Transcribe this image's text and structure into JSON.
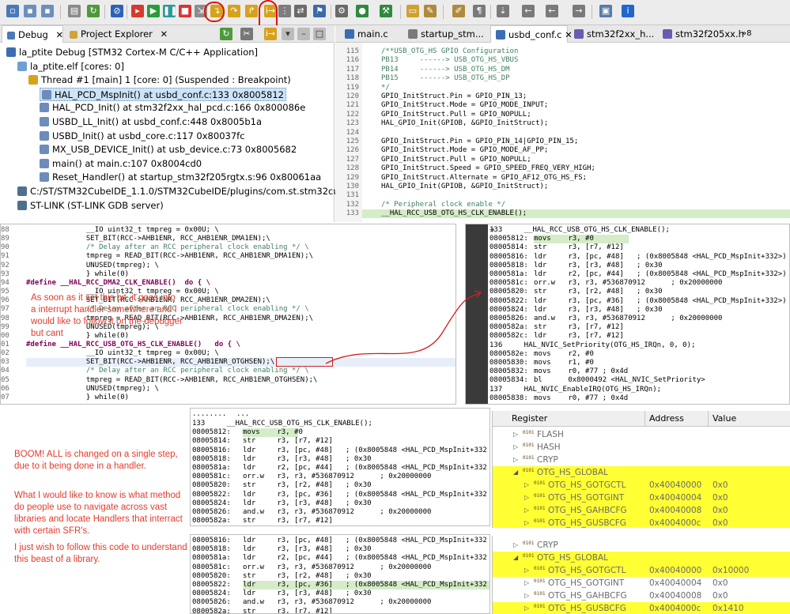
{
  "toolbar": {
    "icons": [
      "new-icon",
      "save-icon",
      "save-all-icon",
      "debug-icon",
      "skip-icon",
      "resume-icon",
      "suspend-icon",
      "terminate-icon",
      "disconnect-icon",
      "step-into-icon",
      "step-over-icon",
      "step-return-icon",
      "instruction-step-icon",
      "build-icon",
      "search-icon",
      "info-icon"
    ],
    "info_label": "i"
  },
  "debug_view": {
    "tabs": [
      {
        "label": "Debug",
        "close": "✕"
      },
      {
        "label": "Project Explorer",
        "close": "✕"
      }
    ],
    "tree": [
      {
        "label": "la_ptite Debug [STM32 Cortex-M C/C++ Application]",
        "indent": 0,
        "icon": "ide"
      },
      {
        "label": "la_ptite.elf [cores: 0]",
        "indent": 1,
        "icon": "app"
      },
      {
        "label": "Thread #1 [main] 1 [core: 0] (Suspended : Breakpoint)",
        "indent": 2,
        "icon": "thread"
      },
      {
        "label": "HAL_PCD_MspInit() at usbd_conf.c:133 0x8005812",
        "indent": 3,
        "icon": "frame",
        "selected": true
      },
      {
        "label": "HAL_PCD_Init() at stm32f2xx_hal_pcd.c:166 0x800086e",
        "indent": 3,
        "icon": "frame"
      },
      {
        "label": "USBD_LL_Init() at usbd_conf.c:448 0x8005b1a",
        "indent": 3,
        "icon": "frame"
      },
      {
        "label": "USBD_Init() at usbd_core.c:117 0x80037fc",
        "indent": 3,
        "icon": "frame"
      },
      {
        "label": "MX_USB_DEVICE_Init() at usb_device.c:73 0x8005682",
        "indent": 3,
        "icon": "frame"
      },
      {
        "label": "main() at main.c:107 0x8004cd0",
        "indent": 3,
        "icon": "frame"
      },
      {
        "label": "Reset_Handler() at startup_stm32f205rgtx.s:96 0x80061aa",
        "indent": 3,
        "icon": "frame"
      },
      {
        "label": "C:/ST/STM32CubeIDE_1.1.0/STM32CubeIDE/plugins/com.st.stm32cube.ide.mc",
        "indent": 1,
        "icon": "gdb"
      },
      {
        "label": "ST-LINK (ST-LINK GDB server)",
        "indent": 1,
        "icon": "gdb"
      }
    ]
  },
  "editor": {
    "tabs": [
      {
        "label": "main.c"
      },
      {
        "label": "startup_stm..."
      },
      {
        "label": "usbd_conf.c",
        "active": true,
        "close": "✕"
      },
      {
        "label": "stm32f2xx_h..."
      },
      {
        "label": "stm32f205xx.h"
      },
      {
        "label": "»8"
      }
    ],
    "lines": [
      {
        "n": "115",
        "t": "/**USB_OTG_HS GPIO Configuration",
        "c": "cm"
      },
      {
        "n": "116",
        "t": "PB13     ------> USB_OTG_HS_VBUS",
        "c": "cm"
      },
      {
        "n": "117",
        "t": "PB14     ------> USB_OTG_HS_DM",
        "c": "cm"
      },
      {
        "n": "118",
        "t": "PB15     ------> USB_OTG_HS_DP",
        "c": "cm"
      },
      {
        "n": "119",
        "t": "*/",
        "c": "cm"
      },
      {
        "n": "120",
        "t": "GPIO_InitStruct.Pin = GPIO_PIN_13;"
      },
      {
        "n": "121",
        "t": "GPIO_InitStruct.Mode = GPIO_MODE_INPUT;"
      },
      {
        "n": "122",
        "t": "GPIO_InitStruct.Pull = GPIO_NOPULL;"
      },
      {
        "n": "123",
        "t": "HAL_GPIO_Init(GPIOB, &GPIO_InitStruct);"
      },
      {
        "n": "124",
        "t": ""
      },
      {
        "n": "125",
        "t": "GPIO_InitStruct.Pin = GPIO_PIN_14|GPIO_PIN_15;"
      },
      {
        "n": "126",
        "t": "GPIO_InitStruct.Mode = GPIO_MODE_AF_PP;"
      },
      {
        "n": "127",
        "t": "GPIO_InitStruct.Pull = GPIO_NOPULL;"
      },
      {
        "n": "128",
        "t": "GPIO_InitStruct.Speed = GPIO_SPEED_FREQ_VERY_HIGH;"
      },
      {
        "n": "129",
        "t": "GPIO_InitStruct.Alternate = GPIO_AF12_OTG_HS_FS;"
      },
      {
        "n": "130",
        "t": "HAL_GPIO_Init(GPIOB, &GPIO_InitStruct);"
      },
      {
        "n": "131",
        "t": ""
      },
      {
        "n": "132",
        "t": "/* Peripheral clock enable */",
        "c": "cm"
      },
      {
        "n": "133",
        "t": "__HAL_RCC_USB_OTG_HS_CLK_ENABLE();",
        "hl": true
      }
    ]
  },
  "macro_pane": {
    "lines": [
      {
        "n": "88",
        "t": "              __IO uint32_t tmpreg = 0x00U; \\"
      },
      {
        "n": "89",
        "t": "              SET_BIT(RCC->AHB1ENR, RCC_AHB1ENR_DMA1EN);\\"
      },
      {
        "n": "90",
        "t": "              /* Delay after an RCC peripheral clock enabling */ \\",
        "c": "cm"
      },
      {
        "n": "91",
        "t": "              tmpreg = READ_BIT(RCC->AHB1ENR, RCC_AHB1ENR_DMA1EN);\\"
      },
      {
        "n": "92",
        "t": "              UNUSED(tmpreg); \\"
      },
      {
        "n": "93",
        "t": "              } while(0)"
      },
      {
        "n": "94",
        "t": "#define __HAL_RCC_DMA2_CLK_ENABLE()  do { \\",
        "c": "kw"
      },
      {
        "n": "95",
        "t": "              __IO uint32_t tmpreg = 0x00U; \\"
      },
      {
        "n": "96",
        "t": "              SET_BIT(RCC->AHB1ENR, RCC_AHB1ENR_DMA2EN);\\"
      },
      {
        "n": "97",
        "t": "              /* Delay after an RCC peripheral clock enabling */ \\",
        "c": "cm"
      },
      {
        "n": "98",
        "t": "              tmpreg = READ_BIT(RCC->AHB1ENR, RCC_AHB1ENR_DMA2EN);\\"
      },
      {
        "n": "99",
        "t": "              UNUSED(tmpreg); \\"
      },
      {
        "n": "00",
        "t": "              } while(0)"
      },
      {
        "n": "01",
        "t": "#define __HAL_RCC_USB_OTG_HS_CLK_ENABLE()   do { \\",
        "c": "kw"
      },
      {
        "n": "02",
        "t": "              __IO uint32_t tmpreg = 0x00U; \\"
      },
      {
        "n": "03",
        "t": "              SET_BIT(RCC->AHB1ENR, RCC_AHB1ENR_OTGHSEN);\\",
        "hl": true
      },
      {
        "n": "04",
        "t": "              /* Delay after an RCC peripheral clock enabling */ \\",
        "c": "cm"
      },
      {
        "n": "05",
        "t": "              tmpreg = READ_BIT(RCC->AHB1ENR, RCC_AHB1ENR_OTGHSEN);\\"
      },
      {
        "n": "06",
        "t": "              UNUSED(tmpreg); \\"
      },
      {
        "n": "07",
        "t": "              } while(0)"
      }
    ],
    "annotation": "As soon as it set this bit, it goes into a interrupt handler somewhere and I would like to follow it on the debugger but cant"
  },
  "disasm_right": {
    "lines": [
      {
        "a": "133",
        "t": "    __HAL_RCC_USB_OTG_HS_CLK_ENABLE();"
      },
      {
        "a": "08005812:",
        "t": "movs    r3, #0",
        "hl": true
      },
      {
        "a": "08005814:",
        "t": "str     r3, [r7, #12]"
      },
      {
        "a": "08005816:",
        "t": "ldr     r3, [pc, #48]   ; (0x8005848 <HAL_PCD_MspInit+332>)"
      },
      {
        "a": "08005818:",
        "t": "ldr     r3, [r3, #48]   ; 0x30"
      },
      {
        "a": "0800581a:",
        "t": "ldr     r2, [pc, #44]   ; (0x8005848 <HAL_PCD_MspInit+332>)"
      },
      {
        "a": "0800581c:",
        "t": "orr.w   r3, r3, #536870912      ; 0x20000000"
      },
      {
        "a": "08005820:",
        "t": "str     r3, [r2, #48]   ; 0x30"
      },
      {
        "a": "08005822:",
        "t": "ldr     r3, [pc, #36]   ; (0x8005848 <HAL_PCD_MspInit+332>)"
      },
      {
        "a": "08005824:",
        "t": "ldr     r3, [r3, #48]   ; 0x30"
      },
      {
        "a": "08005826:",
        "t": "and.w   r3, r3, #536870912      ; 0x20000000"
      },
      {
        "a": "0800582a:",
        "t": "str     r3, [r7, #12]"
      },
      {
        "a": "0800582c:",
        "t": "ldr     r3, [r7, #12]"
      },
      {
        "a": "136",
        "t": "    HAL_NVIC_SetPriority(OTG_HS_IRQn, 0, 0);"
      },
      {
        "a": "0800582e:",
        "t": "movs    r2, #0"
      },
      {
        "a": "08005830:",
        "t": "movs    r1, #0"
      },
      {
        "a": "08005832:",
        "t": "movs    r0, #77 ; 0x4d"
      },
      {
        "a": "08005834:",
        "t": "bl      0x8000492 <HAL_NVIC_SetPriority>"
      },
      {
        "a": "137",
        "t": "    HAL_NVIC_EnableIRQ(OTG_HS_IRQn);"
      },
      {
        "a": "08005838:",
        "t": "movs    r0, #77 ; 0x4d"
      }
    ]
  },
  "boom_note": {
    "paragraphs": [
      "BOOM! ALL is changed on a single step, due to it being done in a handler.",
      "What I would like to know is what method do people use to navigate across vast libraries and locate Handlers that interract with certain SFR's.",
      "I just wish to follow this code to understand this beast of a library."
    ]
  },
  "disasm_top": {
    "header": "........",
    "header2": "...",
    "lines": [
      {
        "a": "133",
        "t": "    __HAL_RCC_USB_OTG_HS_CLK_ENABLE();"
      },
      {
        "a": "08005812:",
        "t": "movs    r3, #0",
        "hl": true
      },
      {
        "a": "08005814:",
        "t": "str     r3, [r7, #12]"
      },
      {
        "a": "08005816:",
        "t": "ldr     r3, [pc, #48]   ; (0x8005848 <HAL_PCD_MspInit+332"
      },
      {
        "a": "08005818:",
        "t": "ldr     r3, [r3, #48]   ; 0x30"
      },
      {
        "a": "0800581a:",
        "t": "ldr     r2, [pc, #44]   ; (0x8005848 <HAL_PCD_MspInit+332"
      },
      {
        "a": "0800581c:",
        "t": "orr.w   r3, r3, #536870912      ; 0x20000000"
      },
      {
        "a": "08005820:",
        "t": "str     r3, [r2, #48]   ; 0x30"
      },
      {
        "a": "08005822:",
        "t": "ldr     r3, [pc, #36]   ; (0x8005848 <HAL_PCD_MspInit+332"
      },
      {
        "a": "08005824:",
        "t": "ldr     r3, [r3, #48]   ; 0x30"
      },
      {
        "a": "08005826:",
        "t": "and.w   r3, r3, #536870912      ; 0x20000000"
      },
      {
        "a": "0800582a:",
        "t": "str     r3, [r7, #12]"
      }
    ]
  },
  "disasm_bottom": {
    "lines": [
      {
        "a": "08005816:",
        "t": "ldr     r3, [pc, #48]   ; (0x8005848 <HAL_PCD_MspInit+332"
      },
      {
        "a": "08005818:",
        "t": "ldr     r3, [r3, #48]   ; 0x30"
      },
      {
        "a": "0800581a:",
        "t": "ldr     r2, [pc, #44]   ; (0x8005848 <HAL_PCD_MspInit+332"
      },
      {
        "a": "0800581c:",
        "t": "orr.w   r3, r3, #536870912      ; 0x20000000"
      },
      {
        "a": "08005820:",
        "t": "str     r3, [r2, #48]   ; 0x30"
      },
      {
        "a": "08005822:",
        "t": "ldr     r3, [pc, #36]   ; (0x8005848 <HAL_PCD_MspInit+332",
        "hl": true
      },
      {
        "a": "08005824:",
        "t": "ldr     r3, [r3, #48]   ; 0x30"
      },
      {
        "a": "08005826:",
        "t": "and.w   r3, r3, #536870912      ; 0x20000000"
      },
      {
        "a": "0800582a:",
        "t": "str     r3, [r7, #12]"
      }
    ]
  },
  "registers_top": {
    "headers": [
      "Register",
      "Address",
      "Value"
    ],
    "rows": [
      {
        "name": "FLASH",
        "addr": "",
        "val": "",
        "level": 1,
        "twist": "▷"
      },
      {
        "name": "HASH",
        "addr": "",
        "val": "",
        "level": 1,
        "twist": "▷"
      },
      {
        "name": "CRYP",
        "addr": "",
        "val": "",
        "level": 1,
        "twist": "▷"
      },
      {
        "name": "OTG_HS_GLOBAL",
        "addr": "",
        "val": "",
        "level": 1,
        "twist": "◢",
        "yellow": true
      },
      {
        "name": "OTG_HS_GOTGCTL",
        "addr": "0x40040000",
        "val": "0x0",
        "level": 2,
        "twist": "▷",
        "yellow": true
      },
      {
        "name": "OTG_HS_GOTGINT",
        "addr": "0x40040004",
        "val": "0x0",
        "level": 2,
        "twist": "▷",
        "yellow": true
      },
      {
        "name": "OTG_HS_GAHBCFG",
        "addr": "0x40040008",
        "val": "0x0",
        "level": 2,
        "twist": "▷",
        "yellow": true
      },
      {
        "name": "OTG_HS_GUSBCFG",
        "addr": "0x4004000c",
        "val": "0x0",
        "level": 2,
        "twist": "▷",
        "yellow": true
      }
    ]
  },
  "registers_bottom": {
    "rows": [
      {
        "name": "CRYP",
        "addr": "",
        "val": "",
        "level": 1,
        "twist": "▷"
      },
      {
        "name": "OTG_HS_GLOBAL",
        "addr": "",
        "val": "",
        "level": 1,
        "twist": "◢",
        "yellow": true
      },
      {
        "name": "OTG_HS_GOTGCTL",
        "addr": "0x40040000",
        "val": "0x10000",
        "level": 2,
        "twist": "▷",
        "yellow": true
      },
      {
        "name": "OTG_HS_GOTGINT",
        "addr": "0x40040004",
        "val": "0x0",
        "level": 2,
        "twist": "▷"
      },
      {
        "name": "OTG_HS_GAHBCFG",
        "addr": "0x40040008",
        "val": "0x0",
        "level": 2,
        "twist": "▷"
      },
      {
        "name": "OTG_HS_GUSBCFG",
        "addr": "0x4004000c",
        "val": "0x1410",
        "level": 2,
        "twist": "▷",
        "yellow": true
      }
    ]
  },
  "colors": {
    "highlight_yellow": "#ffff33",
    "annotation_red": "#e53b2c",
    "line_highlight": "#d4ecc7"
  }
}
